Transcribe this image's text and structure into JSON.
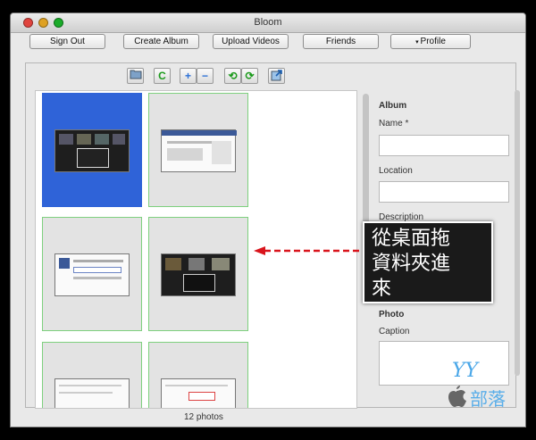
{
  "window": {
    "title": "Bloom"
  },
  "toolbar": {
    "sign_out": "Sign Out",
    "create_album": "Create Album",
    "upload_videos": "Upload Videos",
    "friends": "Friends",
    "profile": "Profile"
  },
  "icons": {
    "folder": "folder-icon",
    "refresh": "C",
    "plus": "+",
    "minus": "−",
    "rotate_left": "⟲",
    "rotate_right": "⟳",
    "export": "export-icon"
  },
  "form": {
    "section_album": "Album",
    "name_label": "Name *",
    "location_label": "Location",
    "description_label": "Description",
    "section_photo": "Photo",
    "caption_label": "Caption"
  },
  "status": {
    "count": "12 photos"
  },
  "callout": {
    "line1": "從桌面拖",
    "line2": "資料夾進",
    "line3": "來"
  },
  "logo": {
    "text": "部落",
    "mark": "YY"
  },
  "colors": {
    "accent": "#2f63d8",
    "thumb_border": "#7ed07e",
    "arrow": "#d9141c"
  }
}
